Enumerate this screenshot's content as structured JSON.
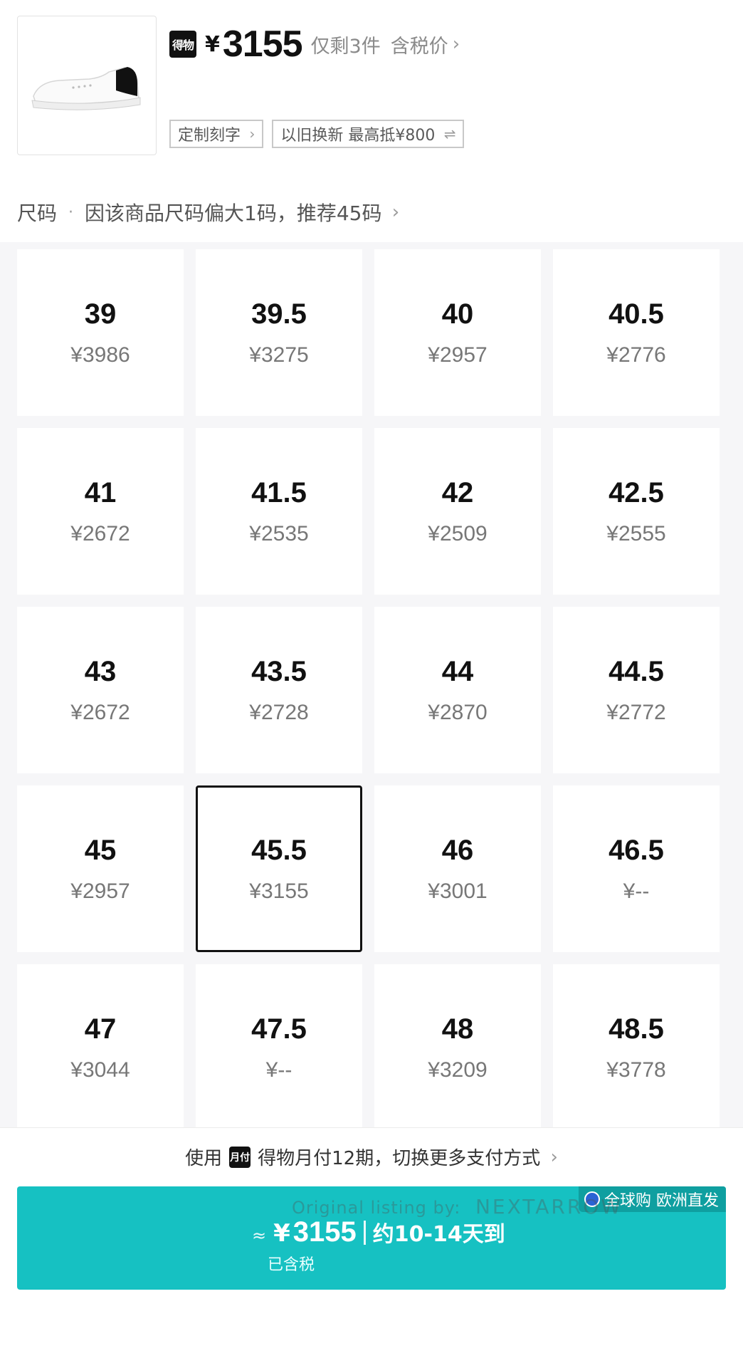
{
  "header": {
    "brand_logo": "得物",
    "currency": "¥",
    "price": "3155",
    "stock_note": "仅剩3件",
    "tax_note": "含税价",
    "tags": [
      {
        "label": "定制刻字",
        "icon": "chevron-right-icon"
      },
      {
        "label": "以旧换新 最高抵¥800",
        "icon": "swap-icon"
      }
    ],
    "size_label": "尺码",
    "size_hint": "因该商品尺码偏大1码，推荐45码"
  },
  "sizes": [
    {
      "size": "39",
      "price": "¥3986"
    },
    {
      "size": "39.5",
      "price": "¥3275"
    },
    {
      "size": "40",
      "price": "¥2957"
    },
    {
      "size": "40.5",
      "price": "¥2776"
    },
    {
      "size": "41",
      "price": "¥2672"
    },
    {
      "size": "41.5",
      "price": "¥2535"
    },
    {
      "size": "42",
      "price": "¥2509"
    },
    {
      "size": "42.5",
      "price": "¥2555"
    },
    {
      "size": "43",
      "price": "¥2672"
    },
    {
      "size": "43.5",
      "price": "¥2728"
    },
    {
      "size": "44",
      "price": "¥2870"
    },
    {
      "size": "44.5",
      "price": "¥2772"
    },
    {
      "size": "45",
      "price": "¥2957"
    },
    {
      "size": "45.5",
      "price": "¥3155"
    },
    {
      "size": "46",
      "price": "¥3001"
    },
    {
      "size": "46.5",
      "price": "¥--"
    },
    {
      "size": "47",
      "price": "¥3044"
    },
    {
      "size": "47.5",
      "price": "¥--"
    },
    {
      "size": "48",
      "price": "¥3209"
    },
    {
      "size": "48.5",
      "price": "¥3778"
    }
  ],
  "selected_size": "45.5",
  "footer": {
    "pay_prefix": "使用",
    "pay_logo": "月付",
    "pay_text": "得物月付12期，切换更多支付方式",
    "approx": "≈",
    "currency": "¥",
    "price": "3155",
    "eta": "约10-14天到",
    "taxed": "已含税",
    "badge": "全球购 欧洲直发"
  },
  "watermark": {
    "text": "Original listing by:",
    "brand": "NEXTARROW"
  },
  "colors": {
    "accent": "#16c1c2",
    "badge": "#0f9fa0",
    "text_dark": "#111111",
    "text_muted": "#8a8a8a"
  }
}
